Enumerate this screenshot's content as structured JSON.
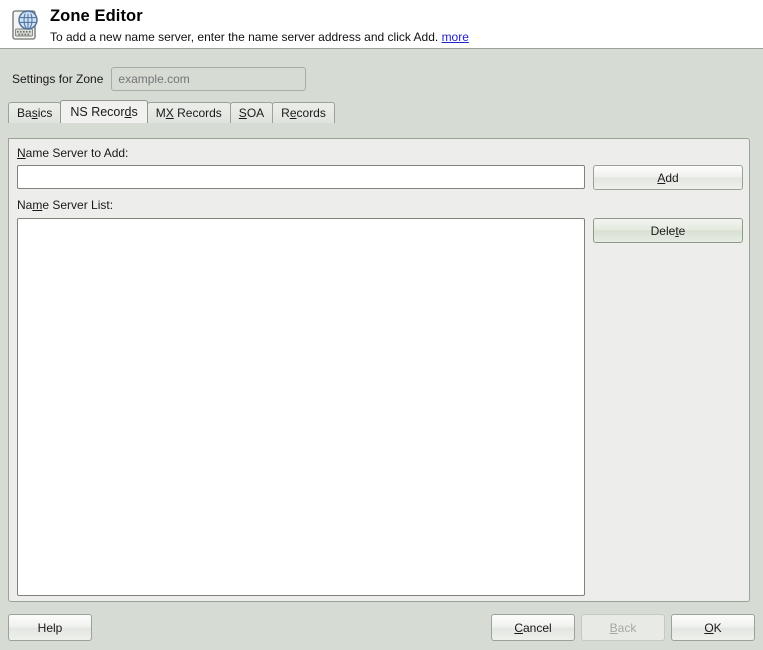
{
  "header": {
    "icon": "dns-zone-icon",
    "title": "Zone Editor",
    "subtitle": "To add a new name server, enter the name server address and click Add.",
    "more_link": "more"
  },
  "zone": {
    "label": "Settings for Zone",
    "value": "",
    "placeholder": "example.com"
  },
  "tabs": [
    {
      "id": "basics",
      "pre": "Ba",
      "mnemonic": "s",
      "post": "ics",
      "active": false
    },
    {
      "id": "ns-records",
      "pre": "NS Recor",
      "mnemonic": "d",
      "post": "s",
      "active": true
    },
    {
      "id": "mx-records",
      "pre": "M",
      "mnemonic": "X",
      "post": " Records",
      "active": false
    },
    {
      "id": "soa",
      "pre": "",
      "mnemonic": "S",
      "post": "OA",
      "active": false
    },
    {
      "id": "records",
      "pre": "R",
      "mnemonic": "e",
      "post": "cords",
      "active": false
    }
  ],
  "panel": {
    "add_label": {
      "pre": "",
      "mnemonic": "N",
      "post": "ame Server to Add:"
    },
    "ns_input_value": "",
    "ns_input_placeholder": "",
    "list_label": {
      "pre": "Na",
      "mnemonic": "m",
      "post": "e Server List:"
    },
    "name_server_list": [],
    "add_button": {
      "pre": "",
      "mnemonic": "A",
      "post": "dd"
    },
    "delete_button": {
      "pre": "Dele",
      "mnemonic": "t",
      "post": "e"
    }
  },
  "footer": {
    "help": {
      "pre": "Help",
      "mnemonic": "",
      "post": ""
    },
    "cancel": {
      "pre": "",
      "mnemonic": "C",
      "post": "ancel"
    },
    "back": {
      "pre": "",
      "mnemonic": "B",
      "post": "ack",
      "disabled": true
    },
    "ok": {
      "pre": "",
      "mnemonic": "O",
      "post": "K"
    }
  },
  "colors": {
    "window_bg": "#d6dbd4",
    "header_bg": "#ffffff",
    "panel_bg": "#edeeec",
    "field_bg": "#ffffff",
    "border": "#9aa39a",
    "link": "#2222cc",
    "delete_button_bg": "#dde4da",
    "disabled_text": "#a3aaa2"
  }
}
